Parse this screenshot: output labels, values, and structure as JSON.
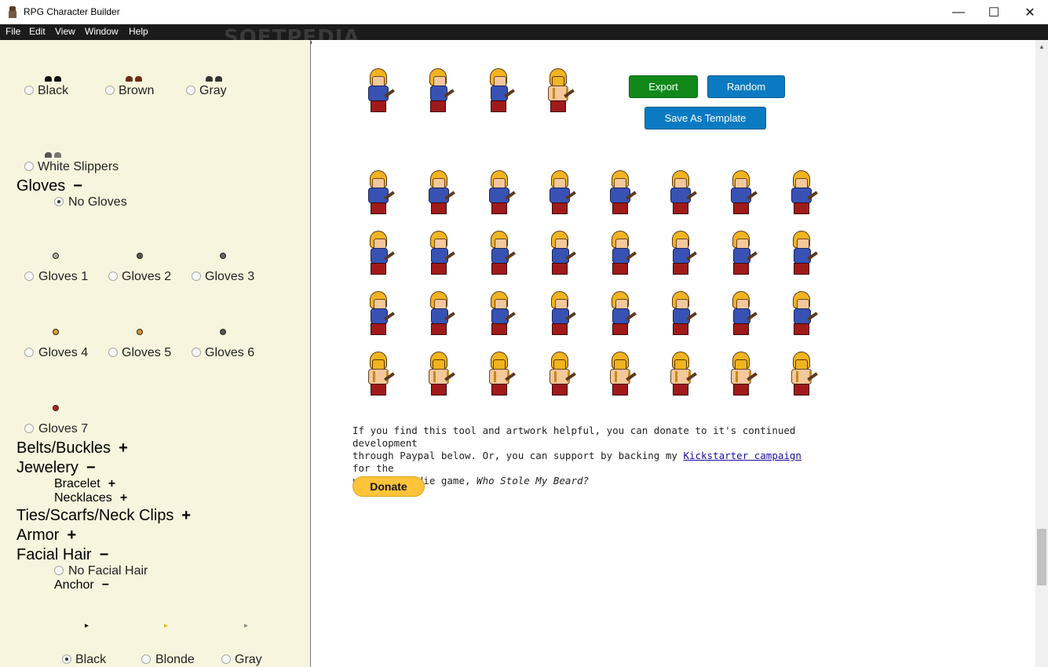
{
  "window": {
    "title": "RPG Character Builder",
    "minimize": "—",
    "maximize": "☐",
    "close": "✕"
  },
  "menu": [
    "File",
    "Edit",
    "Window",
    "Help"
  ],
  "watermark": "SOFTPEDIA",
  "sidebar": {
    "shoe_colors": [
      "Black",
      "Brown",
      "Gray"
    ],
    "slippers_label": "White Slippers",
    "gloves_header": "Gloves",
    "gloves_toggle": "−",
    "no_gloves": "No Gloves",
    "gloves": [
      "Gloves 1",
      "Gloves 2",
      "Gloves 3",
      "Gloves 4",
      "Gloves 5",
      "Gloves 6",
      "Gloves 7"
    ],
    "belts": "Belts/Buckles",
    "jewelery": "Jewelery",
    "bracelet": "Bracelet",
    "necklaces": "Necklaces",
    "ties": "Ties/Scarfs/Neck Clips",
    "armor": "Armor",
    "facial_hair": "Facial Hair",
    "no_facial_hair": "No Facial Hair",
    "anchor": "Anchor",
    "plus": "+",
    "minus": "−",
    "hair_colors": [
      "Black",
      "Blonde",
      "Gray"
    ]
  },
  "main": {
    "export": "Export",
    "random": "Random",
    "save_template": "Save As Template",
    "donate_line1": "If you find this tool and artwork helpful, you can donate to it's continued development",
    "donate_line2a": "through Paypal below. Or, you can support by backing my ",
    "kickstarter_link": "Kickstarter campaign",
    "donate_line2b": " for the",
    "donate_line3a": "upcoming indie game, ",
    "game_title": "Who Stole My Beard?",
    "donate_button": "Donate"
  },
  "colors": {
    "export_btn": "#10891a",
    "random_btn": "#0a7bc2",
    "sidebar_bg": "#f7f5dd"
  }
}
